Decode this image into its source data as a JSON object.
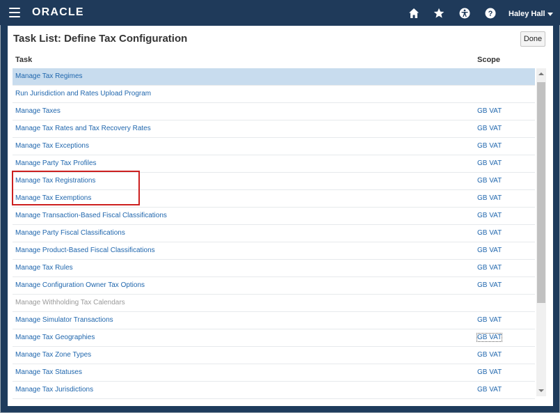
{
  "header": {
    "brand": "ORACLE",
    "user_name": "Haley Hall",
    "icons": [
      "menu-icon",
      "home-icon",
      "star-icon",
      "accessibility-icon",
      "help-icon"
    ]
  },
  "page": {
    "title": "Task List: Define Tax Configuration",
    "done_label": "Done",
    "col_task": "Task",
    "col_scope": "Scope"
  },
  "rows": [
    {
      "task": "Manage Tax Regimes",
      "scope": "",
      "selected": true
    },
    {
      "task": "Run Jurisdiction and Rates Upload Program",
      "scope": ""
    },
    {
      "task": "Manage Taxes",
      "scope": "GB VAT"
    },
    {
      "task": "Manage Tax Rates and Tax Recovery Rates",
      "scope": "GB VAT"
    },
    {
      "task": "Manage Tax Exceptions",
      "scope": "GB VAT"
    },
    {
      "task": "Manage Party Tax Profiles",
      "scope": "GB VAT"
    },
    {
      "task": "Manage Tax Registrations",
      "scope": "GB VAT"
    },
    {
      "task": "Manage Tax Exemptions",
      "scope": "GB VAT"
    },
    {
      "task": "Manage Transaction-Based Fiscal Classifications",
      "scope": "GB VAT"
    },
    {
      "task": "Manage Party Fiscal Classifications",
      "scope": "GB VAT"
    },
    {
      "task": "Manage Product-Based Fiscal Classifications",
      "scope": "GB VAT"
    },
    {
      "task": "Manage Tax Rules",
      "scope": "GB VAT"
    },
    {
      "task": "Manage Configuration Owner Tax Options",
      "scope": "GB VAT"
    },
    {
      "task": "Manage Withholding Tax Calendars",
      "scope": "",
      "disabled": true
    },
    {
      "task": "Manage Simulator Transactions",
      "scope": "GB VAT"
    },
    {
      "task": "Manage Tax Geographies",
      "scope": "GB VAT",
      "focused": true
    },
    {
      "task": "Manage Tax Zone Types",
      "scope": "GB VAT"
    },
    {
      "task": "Manage Tax Statuses",
      "scope": "GB VAT"
    },
    {
      "task": "Manage Tax Jurisdictions",
      "scope": "GB VAT"
    }
  ],
  "colors": {
    "header_bg": "#1f3a5a",
    "link": "#1f66ad",
    "selected_row": "#c8dcee",
    "annotation": "#cc1f1f"
  }
}
